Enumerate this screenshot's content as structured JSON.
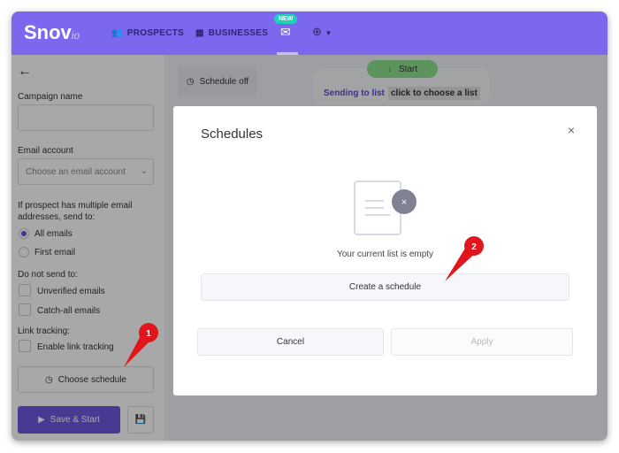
{
  "header": {
    "logo": "Snov",
    "logo_suffix": "io",
    "nav": [
      {
        "label": "PROSPECTS",
        "icon": "people-icon"
      },
      {
        "label": "BUSINESSES",
        "icon": "building-icon"
      }
    ],
    "new_badge": "NEW",
    "mail_icon": "mail-icon",
    "extra_icon": "crosshair-icon"
  },
  "sidebar": {
    "back_icon": "arrow-left-icon",
    "campaign_name_label": "Campaign name",
    "campaign_name_value": "",
    "email_account_label": "Email account",
    "email_account_placeholder": "Choose an email account",
    "multi_label_1": "If prospect has multiple email",
    "multi_label_2": "addresses, send to:",
    "radio_all": "All emails",
    "radio_first": "First email",
    "do_not_send_label": "Do not send to:",
    "unverified": "Unverified emails",
    "catchall": "Catch-all emails",
    "link_tracking_label": "Link tracking:",
    "enable_link_tracking": "Enable link tracking",
    "choose_schedule": "Choose schedule",
    "save_start": "Save & Start"
  },
  "main": {
    "schedule_off": "Schedule off",
    "start": "Start",
    "sending_to_list": "Sending to list",
    "choose_list": "click to choose a list"
  },
  "modal": {
    "title": "Schedules",
    "empty_text": "Your current list is empty",
    "create": "Create a schedule",
    "cancel": "Cancel",
    "apply": "Apply"
  },
  "annotations": [
    "1",
    "2"
  ],
  "colors": {
    "brand": "#7b68ee",
    "annotation": "#e0161c",
    "start": "#8ee08e"
  }
}
